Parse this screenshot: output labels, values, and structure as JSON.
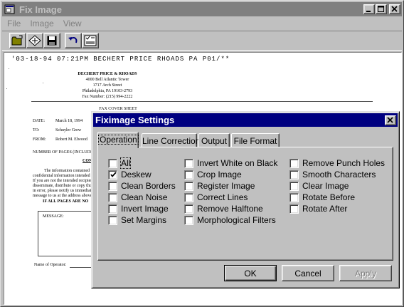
{
  "main_window": {
    "title": "Fix Image",
    "menu": [
      "File",
      "Image",
      "View"
    ],
    "toolbar_icons": [
      "open-folder-icon",
      "new-document-icon",
      "save-disk-icon",
      "undo-arrow-icon",
      "settings-checklist-icon"
    ]
  },
  "fax": {
    "header_line": "'03-18-94 07:21PM BECHERT PRICE RHOADS PA  P01/**",
    "firm_lines": [
      "DECHERT PRICE & RHOADS",
      "4000 Bell Atlantic Tower",
      "1717 Arch Street",
      "Philadelphia, PA 19103-2793"
    ],
    "fax_number": "Fax Number: (215) 994-2222",
    "cover_title": "FAX COVER SHEET",
    "date_label": "DATE:",
    "date_value": "March 18, 1994",
    "to_label": "TO:",
    "to_value": "Schuyler Grew",
    "from_label": "FROM:",
    "from_value": "Robert M. Elwood",
    "pages_label": "NUMBER OF PAGES (INCLUDI",
    "conf_heading": "CONF",
    "body_lines": [
      "The information contained",
      "confidential information intended o",
      "If you are not the intended recipient",
      "disseminate, distribute or copy this",
      "in error, please notify us immediat",
      "message to us at the address above"
    ],
    "notice": "IF ALL PAGES ARE NO",
    "message_label": "MESSAGE:",
    "operator_label": "Name of Operator:"
  },
  "dialog": {
    "title": "Fiximage Settings",
    "tabs": [
      "Operation",
      "Line Correction",
      "Output",
      "File Format"
    ],
    "selected_tab": "Operation",
    "options_col1": [
      {
        "label": "All",
        "checked": false
      },
      {
        "label": "Deskew",
        "checked": true
      },
      {
        "label": "Clean Borders",
        "checked": false
      },
      {
        "label": "Clean Noise",
        "checked": false
      },
      {
        "label": "Invert Image",
        "checked": false
      },
      {
        "label": "Set Margins",
        "checked": false
      }
    ],
    "options_col2": [
      {
        "label": "Invert White on Black",
        "checked": false
      },
      {
        "label": "Crop Image",
        "checked": false
      },
      {
        "label": "Register Image",
        "checked": false
      },
      {
        "label": "Correct Lines",
        "checked": false
      },
      {
        "label": "Remove Halftone",
        "checked": false
      },
      {
        "label": "Morphological Filters",
        "checked": false
      }
    ],
    "options_col3": [
      {
        "label": "Remove Punch Holes",
        "checked": false
      },
      {
        "label": "Smooth Characters",
        "checked": false
      },
      {
        "label": "Clear Image",
        "checked": false
      },
      {
        "label": "Rotate Before",
        "checked": false
      },
      {
        "label": "Rotate After",
        "checked": false
      }
    ],
    "buttons": {
      "ok": "OK",
      "cancel": "Cancel",
      "apply": "Apply"
    }
  }
}
